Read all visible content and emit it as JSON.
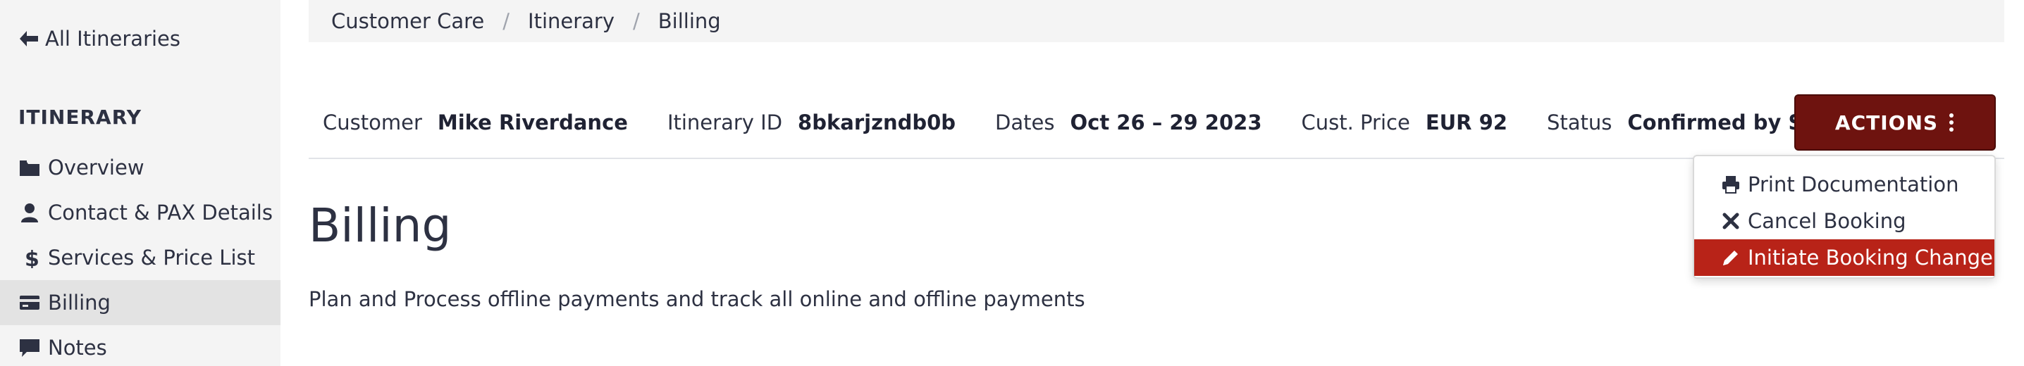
{
  "sidebar": {
    "back_label": "All Itineraries",
    "section_title": "ITINERARY",
    "items": [
      {
        "label": "Overview",
        "icon": "folder-icon"
      },
      {
        "label": "Contact & PAX Details",
        "icon": "user-icon"
      },
      {
        "label": "Services & Price List",
        "icon": "dollar-icon"
      },
      {
        "label": "Billing",
        "icon": "credit-card-icon",
        "active": true
      },
      {
        "label": "Notes",
        "icon": "comment-icon"
      }
    ]
  },
  "breadcrumb": [
    "Customer Care",
    "Itinerary",
    "Billing"
  ],
  "info": {
    "customer_label": "Customer",
    "customer_value": "Mike Riverdance",
    "itinerary_label": "Itinerary ID",
    "itinerary_value": "8bkarjzndb0b",
    "dates_label": "Dates",
    "dates_value": "Oct 26 – 29 2023",
    "price_label": "Cust. Price",
    "price_value": "EUR 92",
    "status_label": "Status",
    "status_value": "Confirmed by Supplier & Paid"
  },
  "actions": {
    "label": "ACTIONS",
    "menu": [
      {
        "label": "Print Documentation",
        "icon": "print-icon"
      },
      {
        "label": "Cancel Booking",
        "icon": "close-icon"
      },
      {
        "label": "Initiate Booking Change",
        "icon": "pencil-icon",
        "highlighted": true
      }
    ]
  },
  "main": {
    "title": "Billing",
    "subtitle": "Plan and Process offline payments and track all online and offline payments"
  },
  "colors": {
    "actions_bg": "#6e130f",
    "highlight_bg": "#b82318",
    "sidebar_bg": "#f4f4f4",
    "active_item_bg": "#e3e3e3"
  }
}
